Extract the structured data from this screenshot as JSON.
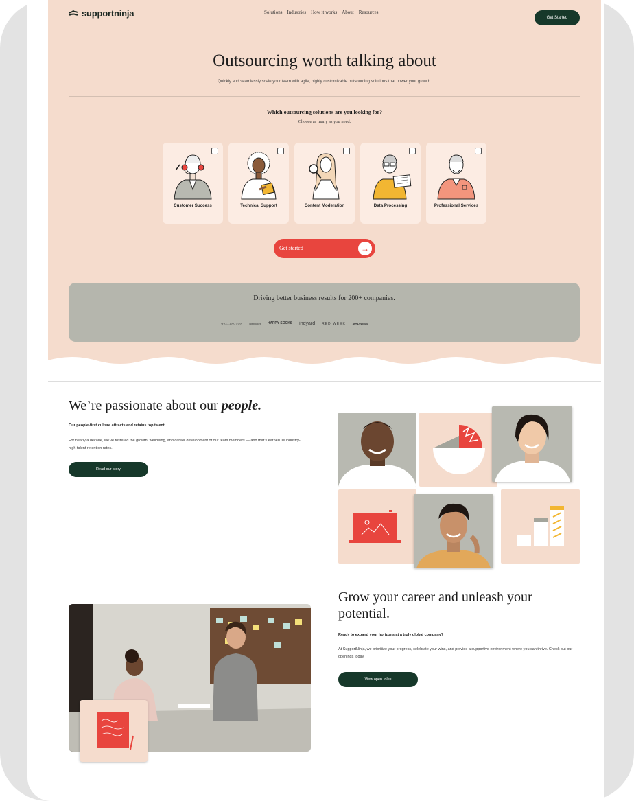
{
  "brand": {
    "name": "supportninja"
  },
  "nav": {
    "links": [
      "Solutions",
      "Industries",
      "How it works",
      "About",
      "Resources"
    ],
    "cta": "Get Started"
  },
  "hero": {
    "title": "Outsourcing worth talking about",
    "subtitle": "Quickly and seamlessly scale your team with agile, highly customizable outsourcing solutions that power your growth.",
    "question": "Which outsourcing solutions are you looking for?",
    "question_sub": "Choose as many as you need.",
    "options": [
      {
        "label": "Customer Success",
        "checked": false
      },
      {
        "label": "Technical Support",
        "checked": false
      },
      {
        "label": "Content Moderation",
        "checked": false
      },
      {
        "label": "Data Processing",
        "checked": false
      },
      {
        "label": "Professional Services",
        "checked": false
      }
    ],
    "cta": "Get started"
  },
  "logos": {
    "title": "Driving better business results for 200+ companies.",
    "companies": [
      "WELLINGTON",
      "Bitbucket",
      "HAPPY SOCKS",
      "indyard",
      "RED WEEK",
      "MADNESS"
    ]
  },
  "people": {
    "title_prefix": "We’re passionate about our ",
    "title_emphasis": "people.",
    "lead": "Our people-first culture attracts and retains top talent.",
    "body": "For nearly a decade, we’ve fostered the growth, wellbeing, and career development of our team members — and that’s earned us industry-high talent retention rates.",
    "cta": "Read our story"
  },
  "career": {
    "title": "Grow your career and unleash your potential.",
    "lead": "Ready to expand your horizons at a truly global company?",
    "body": "At SupportNinja, we prioritize your progress, celebrate your wins, and provide a supportive environment where you can thrive. Check out our openings today.",
    "cta": "View open roles"
  },
  "colors": {
    "peach": "#f5dccd",
    "dark_green": "#16382a",
    "coral": "#e8453e",
    "sage": "#b5b6ad"
  }
}
